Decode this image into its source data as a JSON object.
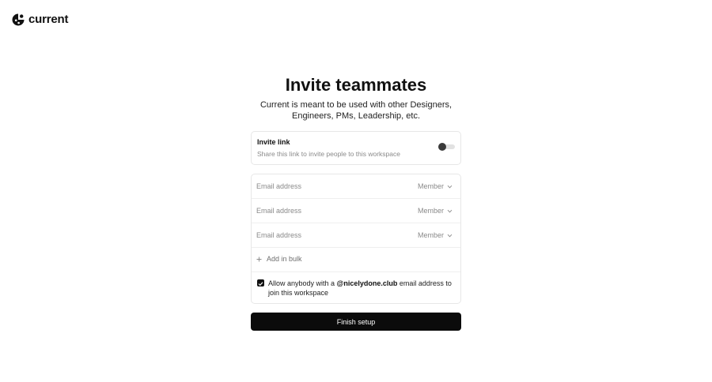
{
  "brand": {
    "name": "current",
    "logo_icon": "current-logo-icon"
  },
  "header": {
    "title": "Invite teammates",
    "subtitle": "Current is meant to be used with other Designers,\nEngineers, PMs, Leadership, etc."
  },
  "invite_link": {
    "title": "Invite link",
    "description": "Share this link to invite people to this workspace",
    "enabled": false
  },
  "invites": {
    "rows": [
      {
        "placeholder": "Email address",
        "value": "",
        "role": "Member"
      },
      {
        "placeholder": "Email address",
        "value": "",
        "role": "Member"
      },
      {
        "placeholder": "Email address",
        "value": "",
        "role": "Member"
      }
    ],
    "add_bulk_label": "Add in bulk"
  },
  "allow_domain": {
    "checked": true,
    "prefix": "Allow anybody with a ",
    "domain": "@nicelydone.club",
    "suffix": " email address to join this workspace"
  },
  "finish_label": "Finish setup",
  "colors": {
    "primary": "#0b0b0b",
    "muted_text": "#8a8a8a",
    "border": "#e7e7e7"
  }
}
